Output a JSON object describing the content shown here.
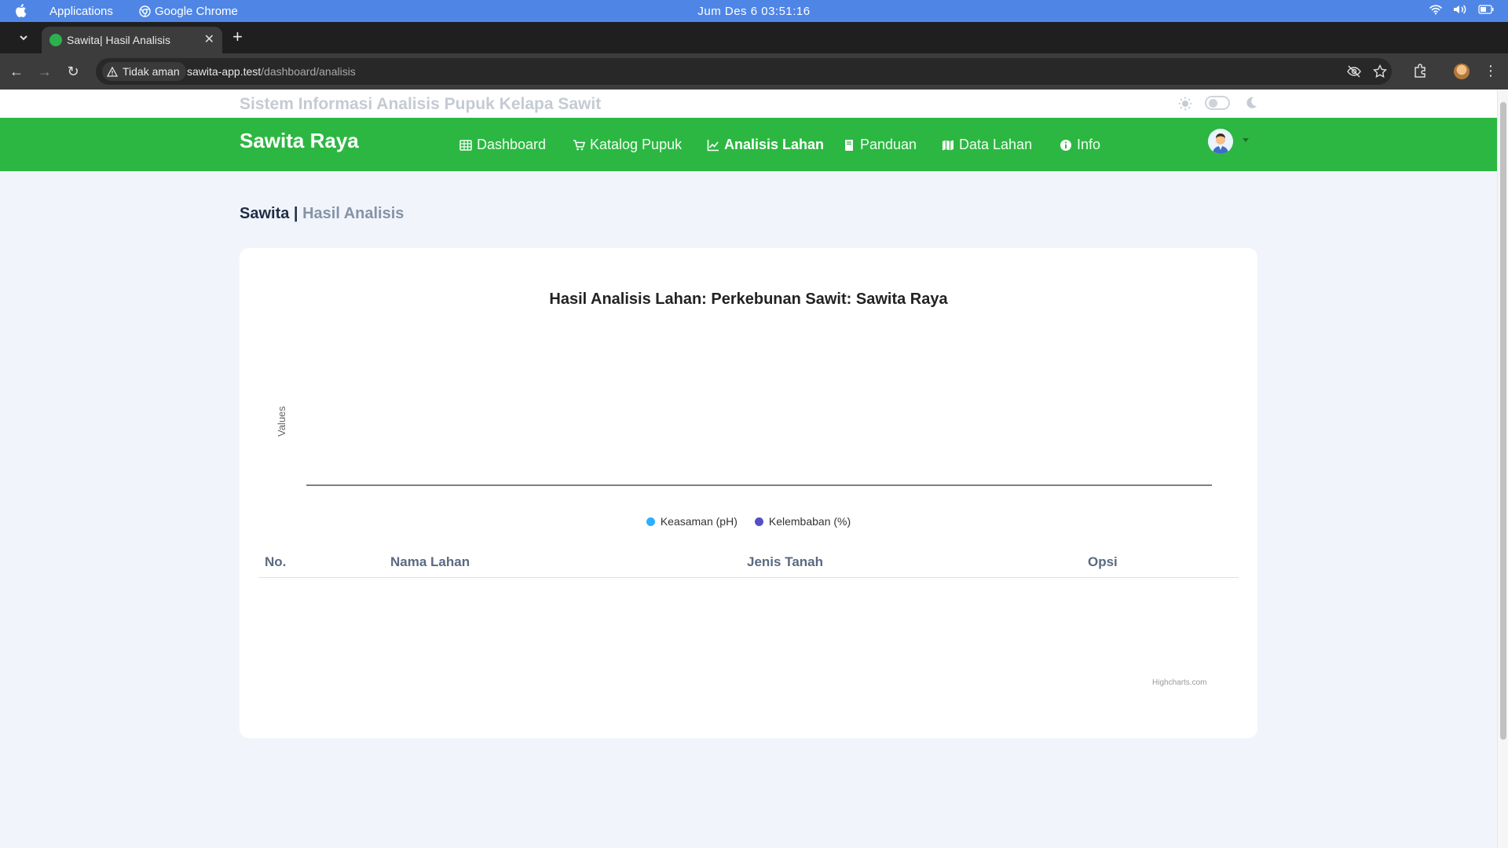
{
  "os_menubar": {
    "app_menu_1": "Applications",
    "app_menu_2": "Google Chrome",
    "clock": "Jum Des 6  03:51:16"
  },
  "browser": {
    "tab_title": "Sawita| Hasil Analisis",
    "security_label": "Tidak aman",
    "url_host": "sawita-app.test",
    "url_path": "/dashboard/analisis"
  },
  "site": {
    "system_title": "Sistem Informasi Analisis Pupuk Kelapa Sawit",
    "brand": "Sawita Raya",
    "nav": [
      {
        "label": "Dashboard",
        "icon": "table-icon",
        "active": false
      },
      {
        "label": "Katalog Pupuk",
        "icon": "cart-icon",
        "active": false
      },
      {
        "label": "Analisis Lahan",
        "icon": "line-chart-icon",
        "active": true
      },
      {
        "label": "Panduan",
        "icon": "book-icon",
        "active": false
      },
      {
        "label": "Data Lahan",
        "icon": "map-icon",
        "active": false
      },
      {
        "label": "Info",
        "icon": "info-icon",
        "active": false
      }
    ],
    "accent": "#2cb742"
  },
  "breadcrumb": {
    "main": "Sawita",
    "separator": "|",
    "sub": "Hasil Analisis"
  },
  "chart_data": {
    "type": "line",
    "title": "Hasil Analisis Lahan: Perkebunan Sawit: Sawita Raya",
    "xlabel": "",
    "ylabel": "Values",
    "categories": [],
    "series": [
      {
        "name": "Keasaman (pH)",
        "color": "#2caffe",
        "values": []
      },
      {
        "name": "Kelembaban (%)",
        "color": "#544fc5",
        "values": []
      }
    ],
    "legend_position": "bottom-center",
    "credits": "Highcharts.com"
  },
  "table": {
    "headers": [
      "No.",
      "Nama Lahan",
      "Jenis Tanah",
      "Opsi"
    ],
    "rows": []
  }
}
